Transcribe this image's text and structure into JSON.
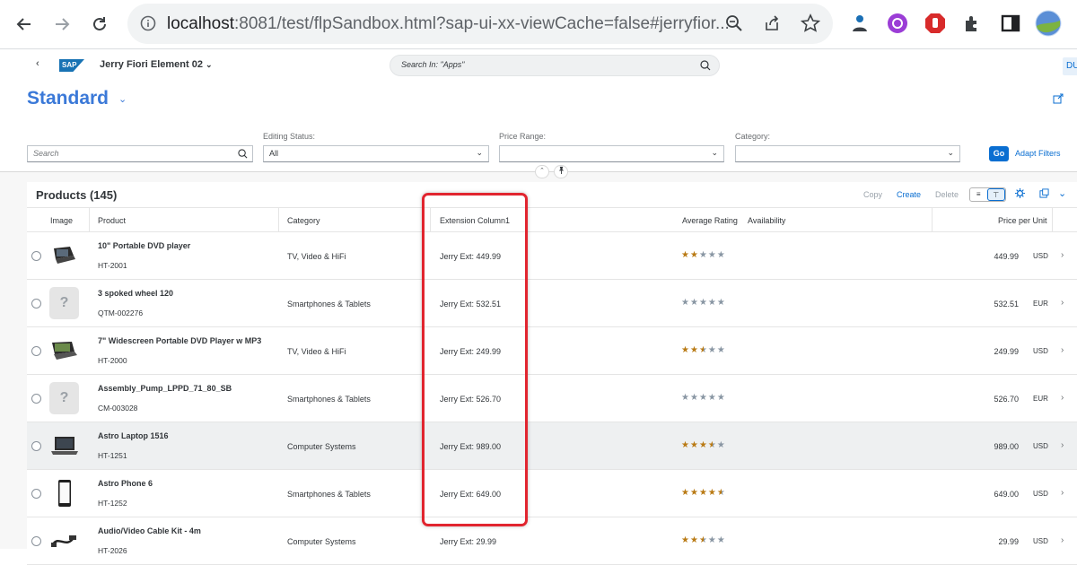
{
  "browser": {
    "url_host": "localhost",
    "url_rest": ":8081/test/flpSandbox.html?sap-ui-xx-viewCache=false#jerryfior..."
  },
  "shell": {
    "logo": "SAP",
    "app_title": "Jerry Fiori Element 02",
    "search_placeholder": "Search In: \"Apps\"",
    "user_initials": "DU"
  },
  "header": {
    "variant": "Standard"
  },
  "filters": {
    "search_placeholder": "Search",
    "editing_status_label": "Editing Status:",
    "editing_status_value": "All",
    "price_range_label": "Price Range:",
    "price_range_value": "",
    "category_label": "Category:",
    "category_value": "",
    "go": "Go",
    "adapt": "Adapt Filters"
  },
  "table": {
    "title": "Products (145)",
    "actions": {
      "copy": "Copy",
      "create": "Create",
      "delete": "Delete"
    },
    "columns": {
      "image": "Image",
      "product": "Product",
      "category": "Category",
      "extension": "Extension Column1",
      "rating": "Average Rating",
      "availability": "Availability",
      "price": "Price per Unit"
    },
    "rows": [
      {
        "name": "10\" Portable DVD player",
        "id": "HT-2001",
        "category": "TV, Video & HiFi",
        "ext": "Jerry Ext: 449.99",
        "rating": 2,
        "price": "449.99",
        "currency": "USD",
        "image": "dvd-player",
        "selected": false
      },
      {
        "name": "3 spoked wheel 120",
        "id": "QTM-002276",
        "category": "Smartphones & Tablets",
        "ext": "Jerry Ext: 532.51",
        "rating": 0,
        "price": "532.51",
        "currency": "EUR",
        "image": "placeholder",
        "selected": false
      },
      {
        "name": "7\" Widescreen Portable DVD Player w MP3",
        "id": "HT-2000",
        "category": "TV, Video & HiFi",
        "ext": "Jerry Ext: 249.99",
        "rating": 2.5,
        "price": "249.99",
        "currency": "USD",
        "image": "dvd-player-wide",
        "selected": false
      },
      {
        "name": "Assembly_Pump_LPPD_71_80_SB",
        "id": "CM-003028",
        "category": "Smartphones & Tablets",
        "ext": "Jerry Ext: 526.70",
        "rating": 0,
        "price": "526.70",
        "currency": "EUR",
        "image": "placeholder",
        "selected": false
      },
      {
        "name": "Astro Laptop 1516",
        "id": "HT-1251",
        "category": "Computer Systems",
        "ext": "Jerry Ext: 989.00",
        "rating": 3.5,
        "price": "989.00",
        "currency": "USD",
        "image": "laptop",
        "selected": true
      },
      {
        "name": "Astro Phone 6",
        "id": "HT-1252",
        "category": "Smartphones & Tablets",
        "ext": "Jerry Ext: 649.00",
        "rating": 4.5,
        "price": "649.00",
        "currency": "USD",
        "image": "phone",
        "selected": false
      },
      {
        "name": "Audio/Video Cable Kit - 4m",
        "id": "HT-2026",
        "category": "Computer Systems",
        "ext": "Jerry Ext: 29.99",
        "rating": 2.5,
        "price": "29.99",
        "currency": "USD",
        "image": "cable",
        "selected": false
      }
    ]
  },
  "colors": {
    "accent": "#0a6ed1",
    "variant": "#3b79d8",
    "star": "#b97a14",
    "highlight": "#e1252f"
  }
}
